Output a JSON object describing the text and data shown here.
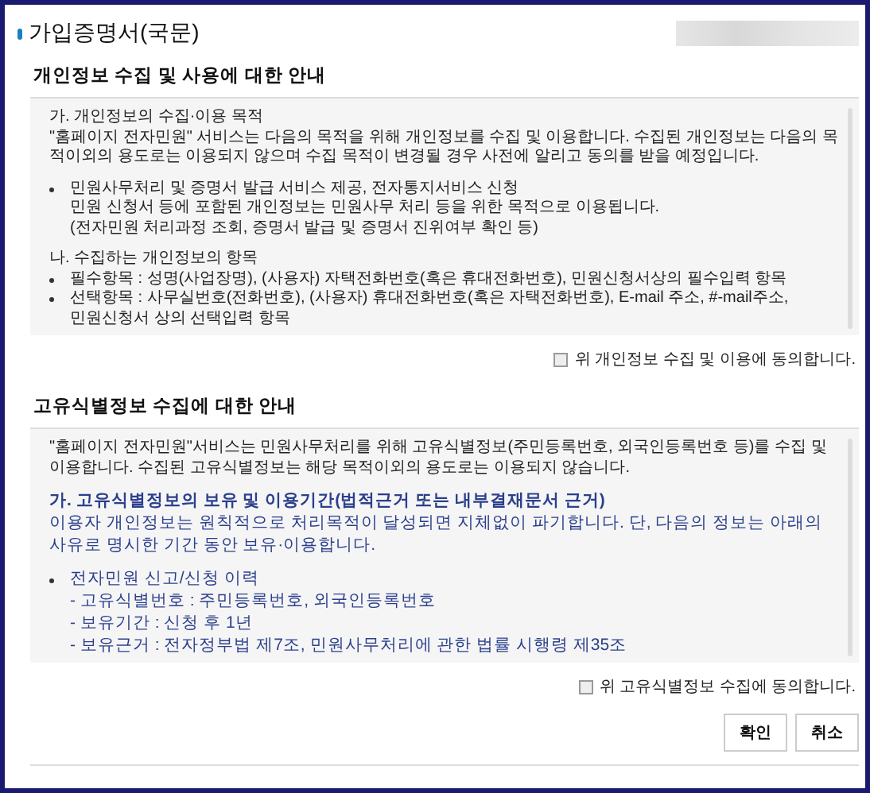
{
  "title": "가입증명서(국문)",
  "sections": [
    {
      "heading": "개인정보 수집 및 사용에 대한 안내",
      "blocks": [
        {
          "kind": "heading",
          "highlight": false,
          "lines": [
            "가. 개인정보의 수집·이용 목적"
          ]
        },
        {
          "kind": "paragraph",
          "highlight": false,
          "lines": [
            "\"홈페이지 전자민원\" 서비스는 다음의 목적을 위해 개인정보를 수집 및 이용합니다. 수집된 개인정보는 다음의 목적이외의 용도로는 이용되지 않으며 수집 목적이 변경될 경우 사전에 알리고 동의를 받을 예정입니다."
          ]
        },
        {
          "kind": "bullet",
          "highlight": false,
          "lines": [
            "민원사무처리 및 증명서 발급 서비스 제공, 전자통지서비스 신청",
            "민원 신청서 등에 포함된 개인정보는 민원사무 처리 등을 위한 목적으로 이용됩니다.",
            "(전자민원 처리과정 조회, 증명서 발급 및 증명서 진위여부 확인 등)"
          ]
        },
        {
          "kind": "heading",
          "highlight": false,
          "lines": [
            "나. 수집하는 개인정보의 항목"
          ]
        },
        {
          "kind": "bullet",
          "highlight": false,
          "lines": [
            "필수항목 : 성명(사업장명), (사용자) 자택전화번호(혹은 휴대전화번호), 민원신청서상의 필수입력 항목"
          ]
        },
        {
          "kind": "bullet",
          "highlight": false,
          "lines": [
            "선택항목 : 사무실번호(전화번호), (사용자) 휴대전화번호(혹은 자택전화번호), E-mail 주소, #-mail주소,",
            "민원신청서 상의 선택입력 항목"
          ]
        }
      ],
      "consent": {
        "label": "위 개인정보 수집 및 이용에 동의합니다.",
        "checked": false
      }
    },
    {
      "heading": "고유식별정보 수집에 대한 안내",
      "blocks": [
        {
          "kind": "paragraph",
          "highlight": false,
          "lines": [
            "\"홈페이지 전자민원\"서비스는 민원사무처리를 위해 고유식별정보(주민등록번호, 외국인등록번호 등)를 수집 및 이용합니다. 수집된 고유식별정보는 해당 목적이외의 용도로는 이용되지 않습니다."
          ]
        },
        {
          "kind": "heading",
          "highlight": true,
          "lines": [
            "가. 고유식별정보의 보유 및 이용기간(법적근거 또는 내부결재문서 근거)"
          ]
        },
        {
          "kind": "paragraph",
          "highlight": true,
          "lines": [
            "이용자 개인정보는 원칙적으로 처리목적이 달성되면 지체없이 파기합니다. 단, 다음의 정보는 아래의 사유로 명시한 기간 동안 보유·이용합니다."
          ]
        },
        {
          "kind": "bullet",
          "highlight": true,
          "lines": [
            "전자민원 신고/신청 이력",
            "- 고유식별번호 : 주민등록번호, 외국인등록번호",
            "- 보유기간 : 신청 후 1년",
            "- 보유근거 : 전자정부법 제7조, 민원사무처리에 관한 법률 시행령 제35조"
          ]
        }
      ],
      "consent": {
        "label": "위 고유식별정보 수집에 동의합니다.",
        "checked": false
      }
    }
  ],
  "buttons": [
    {
      "label": "확인"
    },
    {
      "label": "취소"
    }
  ]
}
